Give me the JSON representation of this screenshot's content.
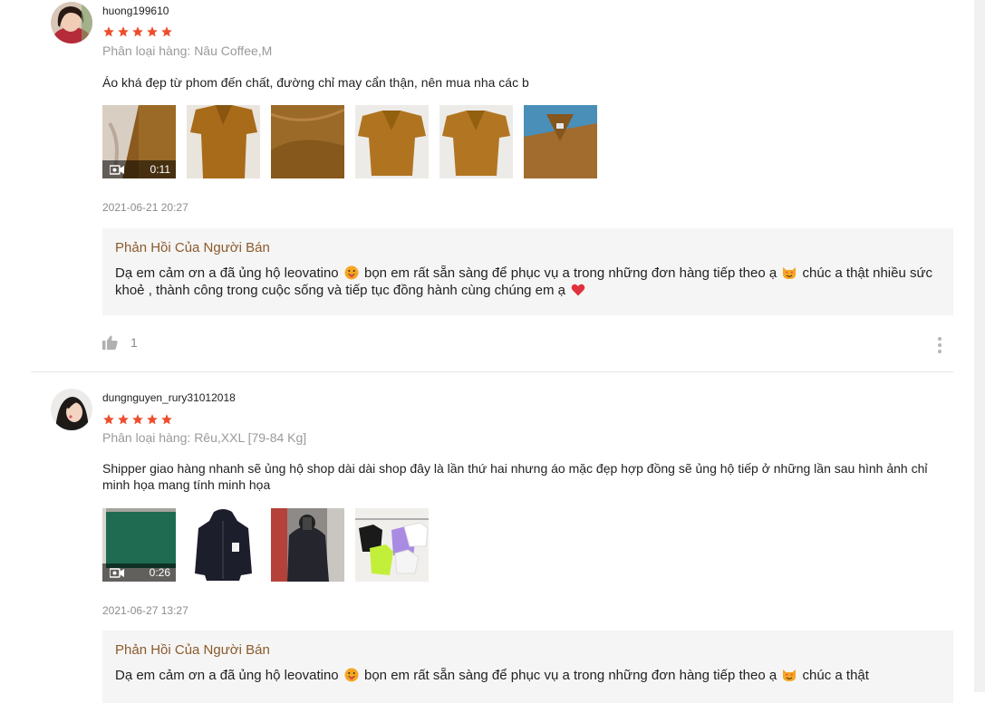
{
  "colors": {
    "star": "#ee4d2d",
    "reply_title": "#8b5a2b",
    "reply_bg": "#f5f5f5"
  },
  "reviews": [
    {
      "username": "huong199610",
      "rating": 5,
      "variation": "Phân loại hàng: Nâu Coffee,M",
      "comment": "Áo khá đẹp từ phom đến chất, đường chỉ may cẩn thận, nên mua nha các b",
      "video_duration": "0:11",
      "timestamp": "2021-06-21 20:27",
      "reply_title": "Phản Hồi Của Người Bán",
      "reply_parts": [
        "Dạ em cảm ơn a đã ủng hộ leovatino",
        "bọn em rất sẵn sàng để phục vụ a trong những đơn hàng tiếp theo ạ",
        "chúc a thật nhiều sức khoẻ , thành công trong cuộc sống và tiếp tục đồng hành cùng chúng em ạ"
      ],
      "likes": "1"
    },
    {
      "username": "dungnguyen_rury31012018",
      "rating": 5,
      "variation": "Phân loại hàng: Rêu,XXL [79-84 Kg]",
      "comment": "Shipper giao hàng nhanh sẽ ủng hộ shop dài dài shop đây là lần thứ hai nhưng áo mặc đẹp hợp đồng sẽ ủng hộ tiếp ở những lần sau hình ảnh chỉ minh họa mang tính minh họa",
      "video_duration": "0:26",
      "timestamp": "2021-06-27 13:27",
      "reply_title": "Phản Hồi Của Người Bán",
      "reply_parts": [
        "Dạ em cảm ơn a đã ủng hộ leovatino",
        "bọn em rất sẵn sàng để phục vụ a trong những đơn hàng tiếp theo ạ",
        "chúc a thật"
      ]
    }
  ]
}
